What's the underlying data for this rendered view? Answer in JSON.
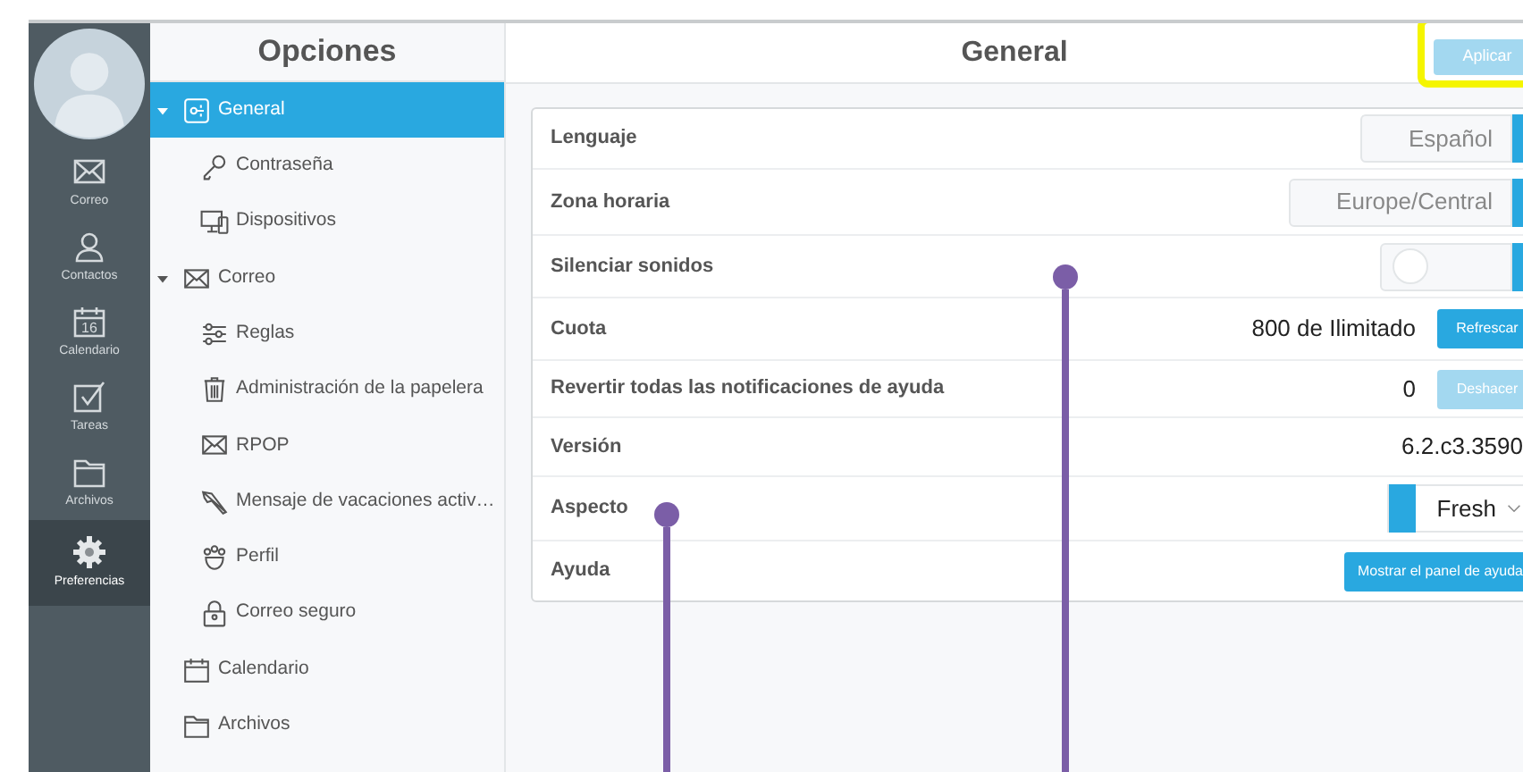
{
  "rail": {
    "items": [
      {
        "label": "Correo",
        "selected": false
      },
      {
        "label": "Contactos",
        "selected": false
      },
      {
        "label": "Calendario",
        "day": "16",
        "selected": false
      },
      {
        "label": "Tareas",
        "selected": false
      },
      {
        "label": "Archivos",
        "selected": false
      },
      {
        "label": "Preferencias",
        "selected": true
      }
    ]
  },
  "options": {
    "title": "Opciones",
    "items": [
      {
        "label": "General",
        "selected": true,
        "expanded": true,
        "children": [
          {
            "label": "Contraseña",
            "selected": false
          },
          {
            "label": "Dispositivos",
            "selected": false
          }
        ]
      },
      {
        "label": "Correo",
        "selected": false,
        "expanded": true,
        "children": [
          {
            "label": "Reglas",
            "selected": false
          },
          {
            "label": "Administración de la papelera",
            "selected": false
          },
          {
            "label": "RPOP",
            "selected": false
          },
          {
            "label": "Mensaje de vacaciones activ…",
            "selected": false
          },
          {
            "label": "Perfil",
            "selected": false
          },
          {
            "label": "Correo seguro",
            "selected": false
          }
        ]
      },
      {
        "label": "Calendario",
        "selected": false
      },
      {
        "label": "Archivos",
        "selected": false
      }
    ]
  },
  "main": {
    "title": "General",
    "apply_button": {
      "label": "Aplicar",
      "disabled": true
    },
    "rows": [
      {
        "kind": "select",
        "label": "Lenguaje",
        "value": "Español"
      },
      {
        "kind": "select",
        "label": "Zona horaria",
        "value": "Europe/Central"
      },
      {
        "kind": "toggle",
        "label": "Silenciar sonidos",
        "on": false
      },
      {
        "kind": "action",
        "label": "Cuota",
        "value": "800 de Ilimitado",
        "button": "Refrescar",
        "disabled": false
      },
      {
        "kind": "action",
        "label": "Revertir todas las notificaciones de ayuda",
        "value": "0",
        "button": "Deshacer",
        "disabled": true
      },
      {
        "kind": "text",
        "label": "Versión",
        "value": "6.2.c3.3590"
      },
      {
        "kind": "dropdown",
        "label": "Aspecto",
        "value": "Fresh"
      },
      {
        "kind": "button",
        "label": "Ayuda",
        "button": "Mostrar el panel de ayuda"
      }
    ]
  }
}
